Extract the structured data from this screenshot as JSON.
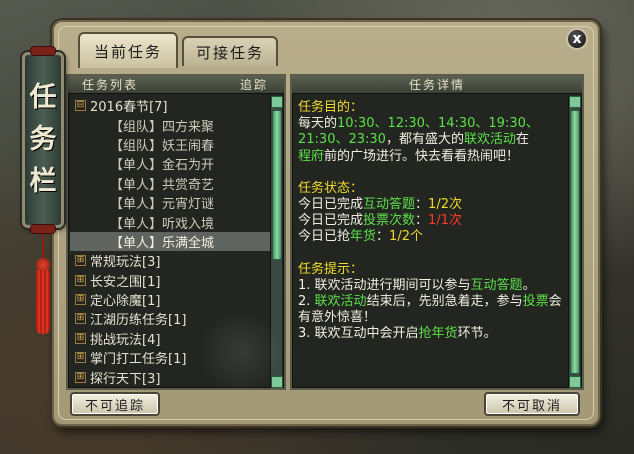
{
  "window": {
    "title": "任务栏",
    "title_chars": [
      "任",
      "务",
      "栏"
    ],
    "close_label": "x"
  },
  "tabs": [
    {
      "label": "当前任务",
      "active": true
    },
    {
      "label": "可接任务",
      "active": false
    }
  ],
  "list_panel": {
    "header_list": "任务列表",
    "header_track": "追踪"
  },
  "tree": [
    {
      "type": "group",
      "toggle": "⊟",
      "label": "2016春节[7]"
    },
    {
      "type": "child",
      "label": "【组队】四方来聚"
    },
    {
      "type": "child",
      "label": "【组队】妖王闹春"
    },
    {
      "type": "child",
      "label": "【单人】金石为开"
    },
    {
      "type": "child",
      "label": "【单人】共赏奇艺"
    },
    {
      "type": "child",
      "label": "【单人】元宵灯谜"
    },
    {
      "type": "child",
      "label": "【单人】听戏入境"
    },
    {
      "type": "child",
      "label": "【单人】乐满全城",
      "selected": true
    },
    {
      "type": "group",
      "toggle": "⊞",
      "label": "常规玩法[3]"
    },
    {
      "type": "group",
      "toggle": "⊞",
      "label": "长安之围[1]"
    },
    {
      "type": "group",
      "toggle": "⊞",
      "label": "定心除魔[1]"
    },
    {
      "type": "group",
      "toggle": "⊞",
      "label": "江湖历练任务[1]"
    },
    {
      "type": "group",
      "toggle": "⊞",
      "label": "挑战玩法[4]"
    },
    {
      "type": "group",
      "toggle": "⊞",
      "label": "掌门打工任务[1]"
    },
    {
      "type": "group",
      "toggle": "⊞",
      "label": "探行天下[3]"
    }
  ],
  "detail_panel": {
    "header": "任务详情",
    "goal_title": "任务目的：",
    "goal": {
      "t1": "每天的",
      "times_line1": "10:30、12:30、14:30、19:30、",
      "times_line2": "21:30、23:30",
      "t2": "，都有盛大的",
      "event": "联欢活动",
      "t3": "在",
      "place": "程府",
      "t4": "前的广场进行。快去看看热闹吧！"
    },
    "status_title": "任务状态：",
    "status": [
      {
        "prefix": "今日已完成",
        "key": "互动答题",
        "sep": "：",
        "value": "1/2次",
        "value_color": "yellow"
      },
      {
        "prefix": "今日已完成",
        "key": "投票次数",
        "sep": "：",
        "value": "1/1次",
        "value_color": "red"
      },
      {
        "prefix": "今日已抢",
        "key": "年货",
        "sep": "：",
        "value": "1/2个",
        "value_color": "yellow"
      }
    ],
    "hint_title": "任务提示：",
    "hints": {
      "h1a": "1. 联欢活动进行期间可以参与",
      "h1b": "互动答题",
      "h1c": "。",
      "h2a": "2. ",
      "h2b": "联欢活动",
      "h2c": "结束后，先别急着走，参与",
      "h2d": "投票",
      "h2e": "会有意外惊喜！",
      "h3a": "3. 联欢互动中会开启",
      "h3b": "抢年货",
      "h3c": "环节。"
    }
  },
  "buttons": {
    "untrack": "不可追踪",
    "abandon": "不可取消"
  }
}
